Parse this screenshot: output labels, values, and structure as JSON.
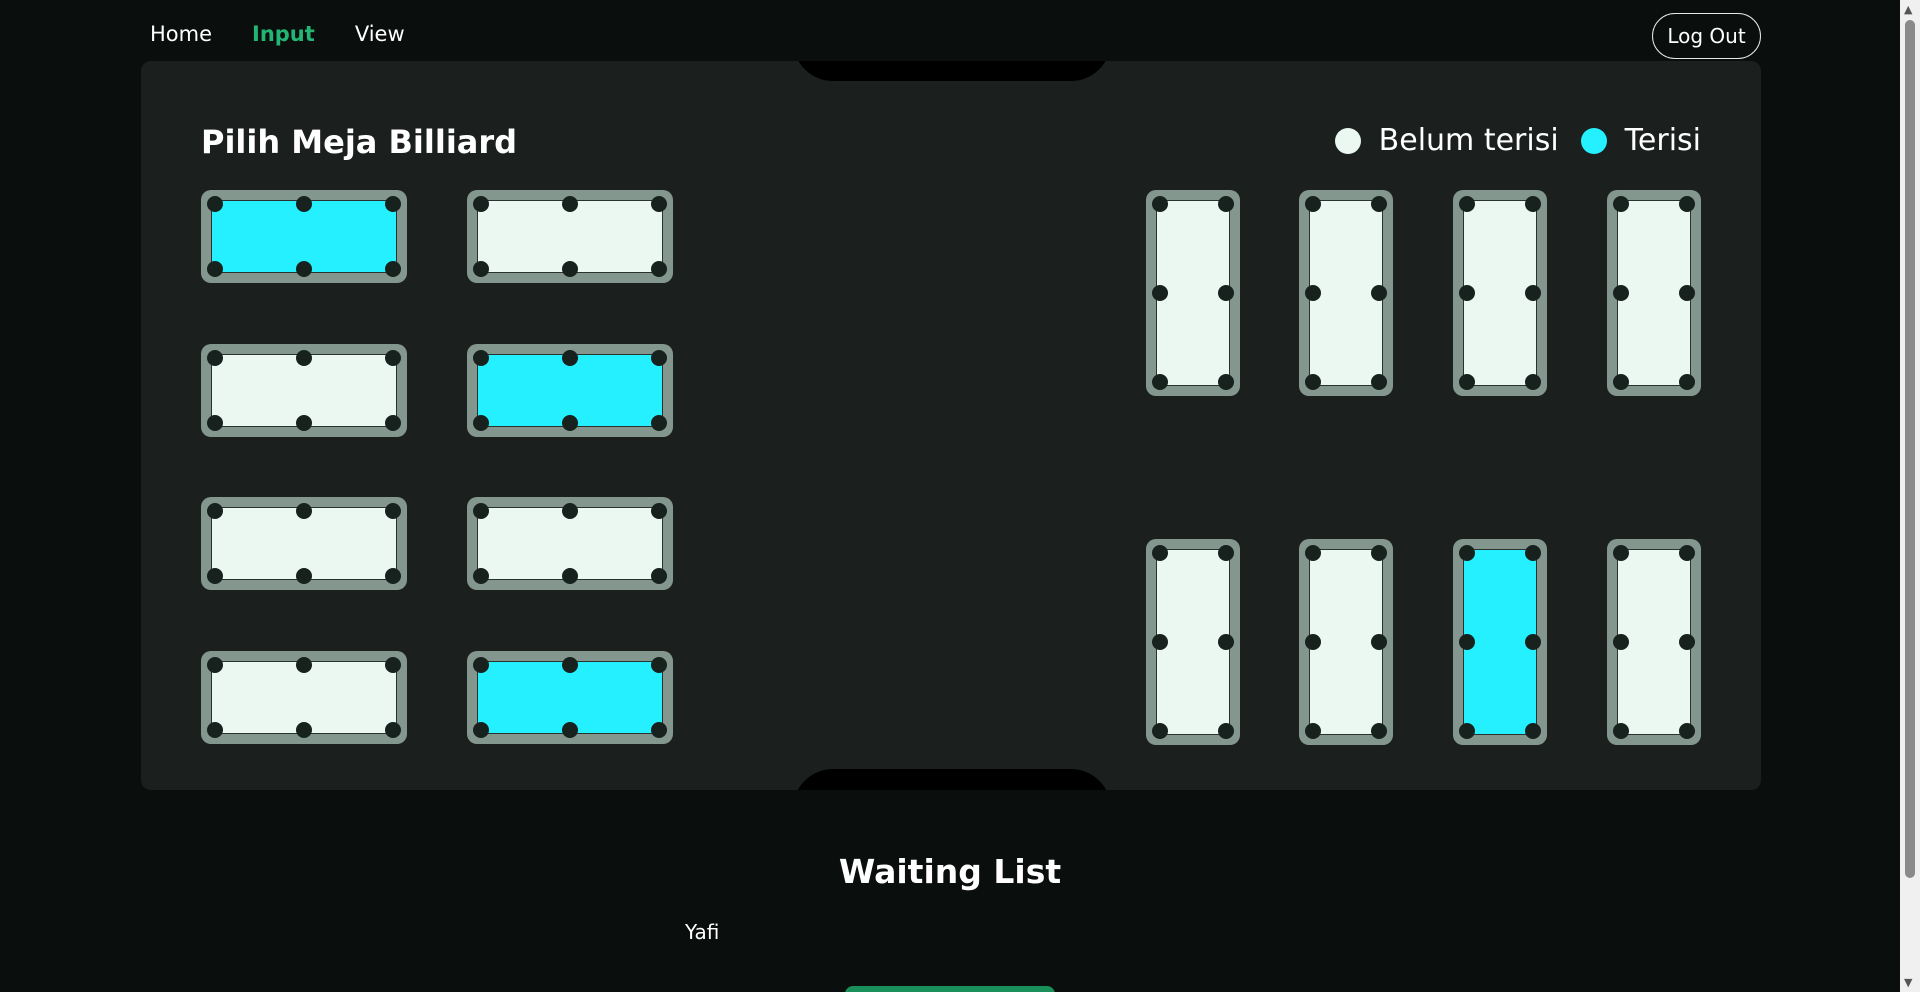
{
  "nav": {
    "links": [
      {
        "label": "Home",
        "active": false
      },
      {
        "label": "Input",
        "active": true
      },
      {
        "label": "View",
        "active": false
      }
    ],
    "logout_label": "Log Out"
  },
  "room": {
    "title": "Pilih Meja Billiard",
    "legend": [
      {
        "label": "Belum terisi",
        "color": "#eaf8f1"
      },
      {
        "label": "Terisi",
        "color": "#24f0ff"
      }
    ],
    "colors": {
      "empty": "#eaf8f1",
      "occupied": "#24f0ff",
      "frame": "#84978e"
    },
    "tables_left": [
      {
        "occupied": true
      },
      {
        "occupied": false
      },
      {
        "occupied": false
      },
      {
        "occupied": true
      },
      {
        "occupied": false
      },
      {
        "occupied": false
      },
      {
        "occupied": false
      },
      {
        "occupied": true
      }
    ],
    "tables_right": [
      {
        "occupied": false
      },
      {
        "occupied": false
      },
      {
        "occupied": false
      },
      {
        "occupied": false
      },
      {
        "occupied": false
      },
      {
        "occupied": false
      },
      {
        "occupied": true
      },
      {
        "occupied": false
      }
    ]
  },
  "waiting_list": {
    "title": "Waiting List",
    "names": [
      "Yafi"
    ]
  }
}
